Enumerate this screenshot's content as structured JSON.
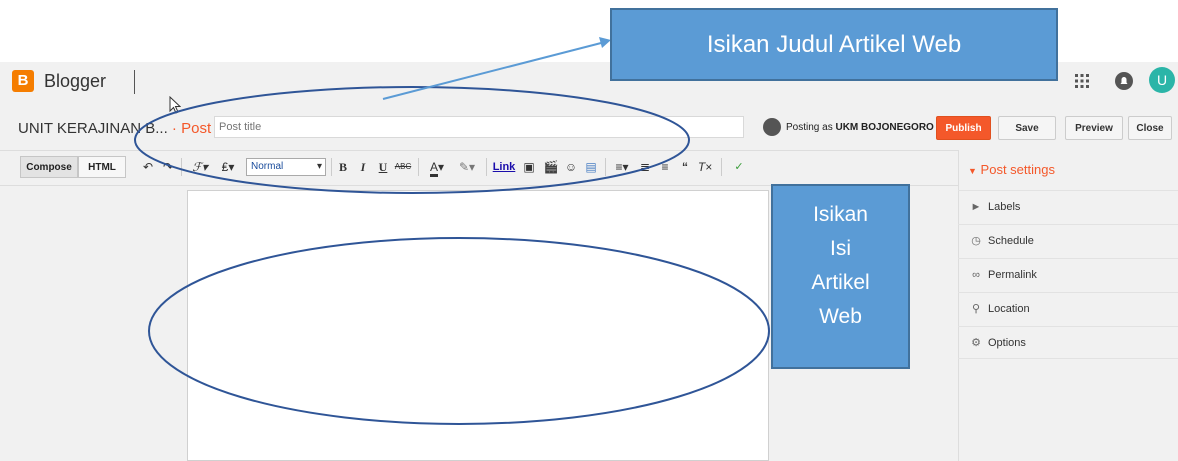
{
  "app": {
    "logo_letter": "B",
    "brand": "Blogger",
    "avatar_letter": "U"
  },
  "post_bar": {
    "blog_name": "UNIT KERAJINAN B...",
    "crumb_sep": " · ",
    "crumb_post": "Post",
    "title_placeholder": "Post title",
    "posting_as_prefix": "Posting as",
    "posting_as_user": "UKM BOJONEGORO",
    "publish": "Publish",
    "save": "Save",
    "preview": "Preview",
    "close": "Close"
  },
  "toolbar": {
    "compose": "Compose",
    "html": "HTML",
    "font_size_select": "Normal",
    "link": "Link"
  },
  "sidebar": {
    "header": "Post settings",
    "items": [
      {
        "label": "Labels",
        "icon": "tag-icon"
      },
      {
        "label": "Schedule",
        "icon": "clock-icon"
      },
      {
        "label": "Permalink",
        "icon": "link-icon"
      },
      {
        "label": "Location",
        "icon": "pin-icon"
      },
      {
        "label": "Options",
        "icon": "gear-icon"
      }
    ]
  },
  "annotations": {
    "title_callout": "Isikan Judul Artikel Web",
    "body_callout": "Isikan\nIsi\nArtikel\nWeb"
  },
  "colors": {
    "accent": "#f4582a",
    "brand_orange": "#f57d00",
    "callout_fill": "#5b9bd5",
    "callout_border": "#41719c",
    "ellipse_stroke": "#2f5597",
    "avatar": "#2bb5a8"
  }
}
